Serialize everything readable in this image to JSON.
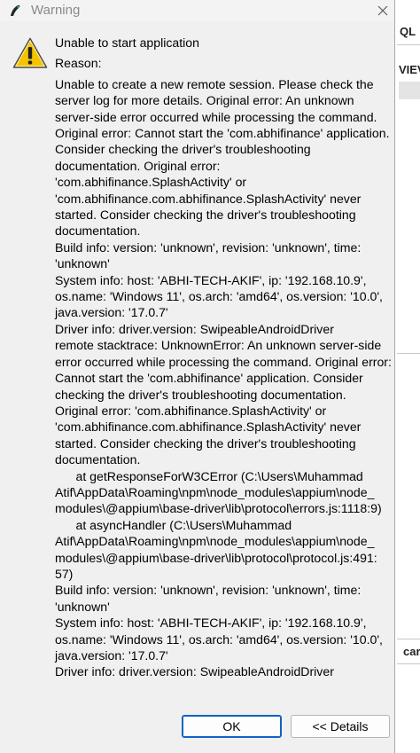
{
  "window": {
    "title": "Warning",
    "close_glyph": "✕"
  },
  "message": {
    "heading": "Unable to start application",
    "reason_label": "Reason:",
    "body": "Unable to create a new remote session. Please check the server log for more details. Original error: An unknown server-side error occurred while processing the command. Original error: Cannot start the 'com.abhifinance' application. Consider checking the driver's troubleshooting documentation. Original error: 'com.abhifinance.SplashActivity' or 'com.abhifinance.com.abhifinance.SplashActivity' never started. Consider checking the driver's troubleshooting documentation.\nBuild info: version: 'unknown', revision: 'unknown', time: 'unknown'\nSystem info: host: 'ABHI-TECH-AKIF', ip: '192.168.10.9', os.name: 'Windows 11', os.arch: 'amd64', os.version: '10.0', java.version: '17.0.7'\nDriver info: driver.version: SwipeableAndroidDriver\nremote stacktrace: UnknownError: An unknown server-side error occurred while processing the command. Original error: Cannot start the 'com.abhifinance' application. Consider checking the driver's troubleshooting documentation.\nOriginal error: 'com.abhifinance.SplashActivity' or 'com.abhifinance.com.abhifinance.SplashActivity' never started. Consider checking the driver's troubleshooting documentation.\n      at getResponseForW3CError (C:\\Users\\Muhammad Atif\\AppData\\Roaming\\npm\\node_modules\\appium\\node_\nmodules\\@appium\\base-driver\\lib\\protocol\\errors.js:1118:9)\n      at asyncHandler (C:\\Users\\Muhammad Atif\\AppData\\Roaming\\npm\\node_modules\\appium\\node_\nmodules\\@appium\\base-driver\\lib\\protocol\\protocol.js:491:\n57)\nBuild info: version: 'unknown', revision: 'unknown', time: 'unknown'\nSystem info: host: 'ABHI-TECH-AKIF', ip: '192.168.10.9', os.name: 'Windows 11', os.arch: 'amd64', os.version: '10.0', java.version: '17.0.7'\nDriver info: driver.version: SwipeableAndroidDriver"
  },
  "buttons": {
    "ok": "OK",
    "details": "<< Details"
  },
  "background_app": {
    "top_label": "QL",
    "view_label": "VIEV",
    "bottom_label": "car"
  },
  "colors": {
    "dialog_bg": "#f0f0f0",
    "warning_yellow": "#f5c400",
    "default_button_border": "#0f62c4"
  },
  "icons": {
    "app": "app-logo-icon",
    "close": "close-icon",
    "warning": "warning-icon"
  }
}
